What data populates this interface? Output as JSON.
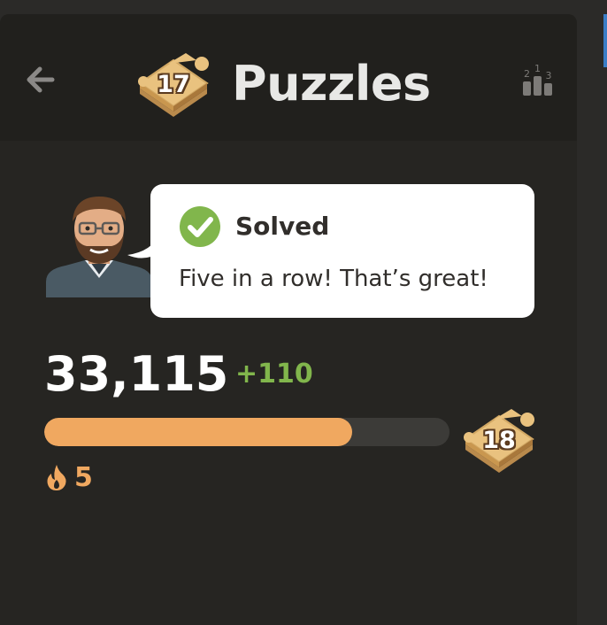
{
  "header": {
    "title": "Puzzles",
    "level_badge": "17",
    "back_icon": "arrow-left-icon",
    "leaderboard_icon": "leaderboard-icon",
    "leaderboard_ranks": [
      "2",
      "1",
      "3"
    ]
  },
  "feedback": {
    "status": "Solved",
    "message": "Five in a row! That’s great!",
    "status_icon": "checkmark-circle-icon",
    "coach_avatar": "coach-avatar"
  },
  "rating": {
    "value": "33,115",
    "delta": "+110",
    "progress_fraction": 0.76,
    "next_level_badge": "18"
  },
  "streak": {
    "icon": "flame-icon",
    "count": "5"
  },
  "colors": {
    "background": "#262522",
    "header": "#21201d",
    "success_green": "#81b64c",
    "progress_orange": "#f0a860",
    "text_light": "#ffffff"
  }
}
